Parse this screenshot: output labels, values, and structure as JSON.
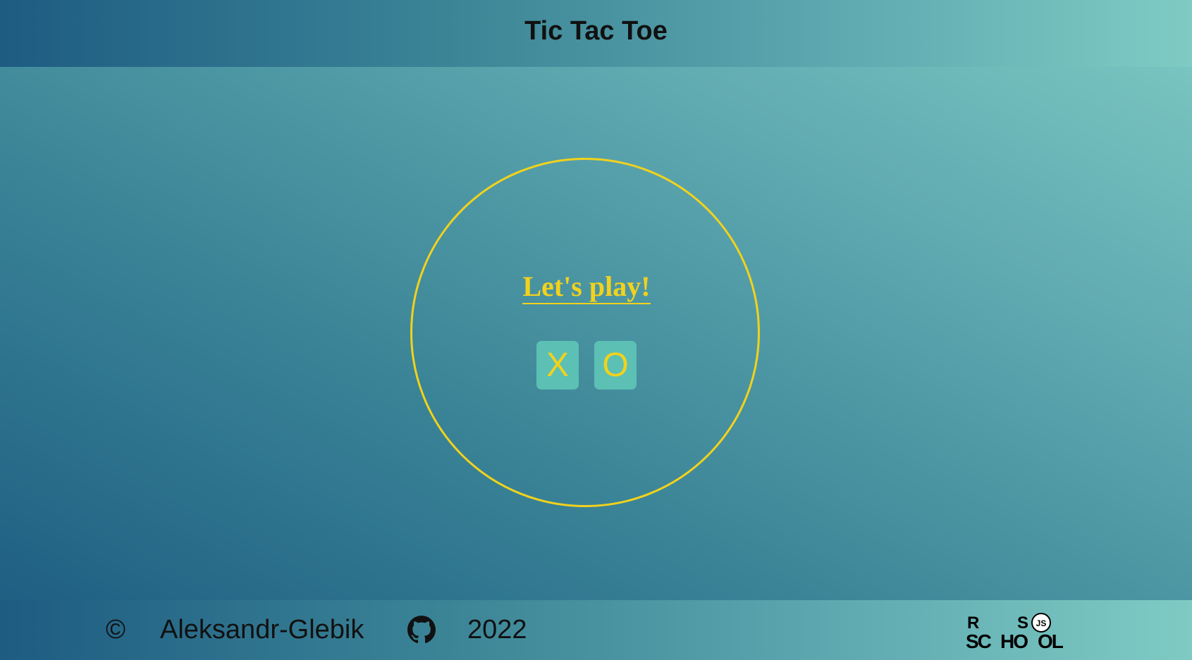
{
  "header": {
    "title": "Tic Tac Toe"
  },
  "main": {
    "prompt": "Let's play!",
    "choices": [
      {
        "label": "X"
      },
      {
        "label": "O"
      }
    ]
  },
  "footer": {
    "copyright_symbol": "©",
    "author": "Aleksandr-Glebik",
    "github_icon": "github-icon",
    "year": "2022",
    "logo_icon": "rs-school-logo",
    "logo_letters": {
      "r": "R",
      "s": "S",
      "js": "JS",
      "sc": "SC",
      "ho": "HO",
      "ol": "OL"
    }
  },
  "colors": {
    "accent": "#f2d21c",
    "button_bg": "#5cc0b4",
    "text": "#111111"
  }
}
